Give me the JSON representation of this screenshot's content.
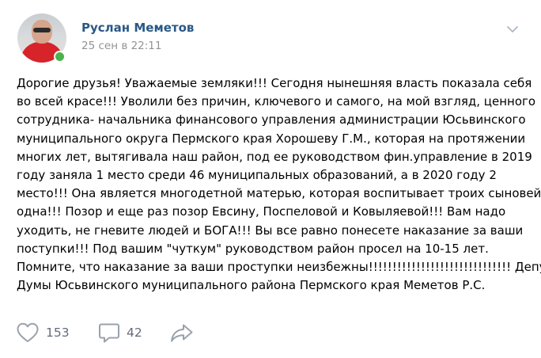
{
  "post": {
    "author_name": "Руслан Меметов",
    "date": "25 сен в 22:11",
    "online": true,
    "text_lines": [
      "Дорогие друзья! Уважаемые земляки!!! Сегодня нынешняя власть показала себя",
      "во всей красе!!! Уволили без причин, ключевого и самого, на мой взгляд, ценного",
      "сотрудника- начальника финансового управления администрации Юсьвинского",
      "муниципального округа Пермского края Хорошеву Г.М., которая на протяжении",
      "многих лет, вытягивала наш район, под ее руководством фин.управление в 2019",
      "году заняла 1 место среди 46 муниципальных образований, а в 2020 году 2",
      "место!!! Она является многодетной матерью, которая воспитывает троих сыновей",
      "одна!!! Позор и еще раз позор Евсину, Поспеловой и Ковыляевой!!! Вам надо",
      "уходить, не гневите людей и БОГА!!! Вы все равно понесете наказание за ваши",
      "поступки!!! Под вашим \"чуткум\" руководством район просел на 10-15 лет.",
      "Помните, что наказание за ваши проступки неизбежны!!!!!!!!!!!!!!!!!!!!!!!!!!!!!! Депутат",
      "Думы Юсьвинского муниципального района Пермского края Меметов Р.С."
    ]
  },
  "actions": {
    "likes": "153",
    "comments": "42",
    "like_icon": "heart-icon",
    "comment_icon": "comment-bubble-icon",
    "share_icon": "share-arrow-icon"
  },
  "colors": {
    "author": "#2a5885",
    "date": "#939393",
    "icon": "#99a2ad",
    "count": "#626d7a",
    "online": "#4bb34b"
  }
}
